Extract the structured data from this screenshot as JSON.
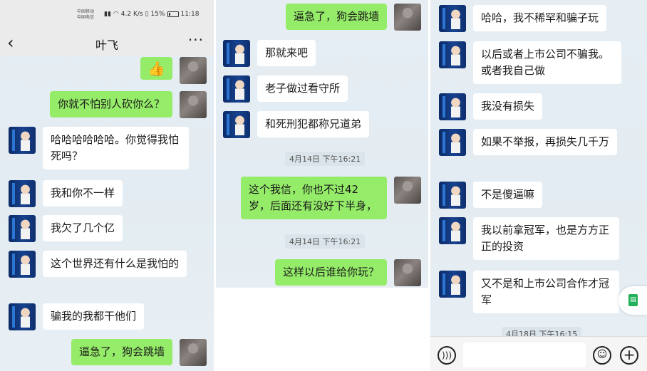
{
  "status_bar": {
    "carrier1": "中国移动",
    "carrier2": "中国电信",
    "net_speed": "4.2 K/s",
    "battery": "15%",
    "time": "11:18"
  },
  "header": {
    "title": "叶飞"
  },
  "panel1": {
    "m1": "👍",
    "m2": "你就不怕别人砍你么？",
    "m3": "哈哈哈哈哈哈。你觉得我怕死吗？",
    "m4": "我和你不一样",
    "m5": "我欠了几个亿",
    "m6": "这个世界还有什么是我怕的",
    "m7": "骗我的我都干他们",
    "m8": "逼急了，狗会跳墙"
  },
  "panel2": {
    "m1": "逼急了，狗会跳墙",
    "m2": "那就来吧",
    "m3": "老子做过看守所",
    "m4": "和死刑犯都称兄道弟",
    "t1": "4月14日 下午16:21",
    "m5": "这个我信，你也不过42岁，后面还有没好下半身，",
    "t2": "4月14日 下午16:21",
    "m6": "这样以后谁给你玩？"
  },
  "panel3": {
    "m1": "哈哈，我不稀罕和骗子玩",
    "m2": "以后或者上市公司不骗我。或者我自己做",
    "m3": "我没有损失",
    "m4": "如果不举报，再损失几千万",
    "m5": "不是傻逼嘛",
    "m6": "我以前拿冠军，也是方方正正的投资",
    "m7": "又不是和上市公司合作才冠军",
    "t1": "4月18日 下午16:15"
  },
  "input_bar": {
    "voice_icon": "voice-icon",
    "emoji_icon": "emoji-icon",
    "plus_icon": "plus-icon"
  }
}
